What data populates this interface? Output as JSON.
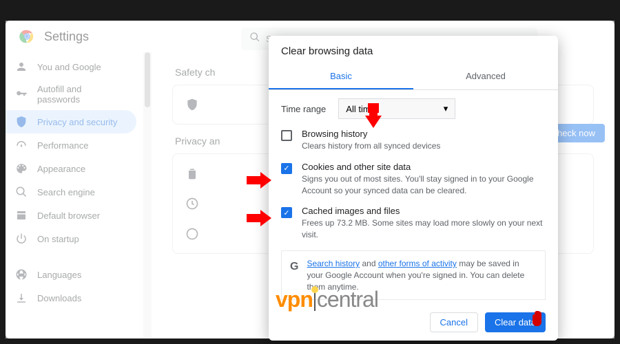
{
  "header": {
    "title": "Settings"
  },
  "sidebar": {
    "items": [
      {
        "label": "You and Google"
      },
      {
        "label": "Autofill and passwords"
      },
      {
        "label": "Privacy and security",
        "active": true
      },
      {
        "label": "Performance"
      },
      {
        "label": "Appearance"
      },
      {
        "label": "Search engine"
      },
      {
        "label": "Default browser"
      },
      {
        "label": "On startup"
      },
      {
        "label": "Languages"
      },
      {
        "label": "Downloads"
      }
    ]
  },
  "search": {
    "placeholder": "Se"
  },
  "main": {
    "safety_check_label": "Safety ch",
    "check_now": "Check now",
    "privacy_label": "Privacy an"
  },
  "dialog": {
    "title": "Clear browsing data",
    "tabs": {
      "basic": "Basic",
      "advanced": "Advanced"
    },
    "time_range_label": "Time range",
    "time_range_value": "All time",
    "items": [
      {
        "title": "Browsing history",
        "sub": "Clears history from all synced devices",
        "checked": false
      },
      {
        "title": "Cookies and other site data",
        "sub": "Signs you out of most sites. You'll stay signed in to your Google Account so your synced data can be cleared.",
        "checked": true
      },
      {
        "title": "Cached images and files",
        "sub": "Frees up 73.2 MB. Some sites may load more slowly on your next visit.",
        "checked": true
      }
    ],
    "info": {
      "link1": "Search history",
      "mid": " and ",
      "link2": "other forms of activity",
      "text": " may be saved in your Google Account when you're signed in. You can delete them anytime."
    },
    "cancel": "Cancel",
    "clear": "Clear data"
  },
  "watermark": {
    "vpn": "vpn",
    "central": "central"
  }
}
